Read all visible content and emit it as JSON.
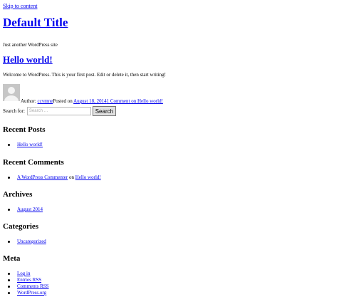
{
  "skip_link": "Skip to content",
  "site": {
    "title": "Default Title",
    "description": "Just another WordPress site"
  },
  "post": {
    "title": "Hello world!",
    "content": "Welcome to WordPress. This is your first post. Edit or delete it, then start writing!",
    "author_prefix": "Author:",
    "author": "ccvmne",
    "posted_prefix": "Posted on",
    "date": "August 18, 2014",
    "comments_link": "1 Comment on Hello world!"
  },
  "search": {
    "label": "Search for:",
    "placeholder": "Search …",
    "button": "Search"
  },
  "widgets": {
    "recent_posts": {
      "title": "Recent Posts",
      "items": [
        "Hello world!"
      ]
    },
    "recent_comments": {
      "title": "Recent Comments",
      "author": "A WordPress Commenter",
      "on": "on",
      "post": "Hello world!"
    },
    "archives": {
      "title": "Archives",
      "items": [
        "August 2014"
      ]
    },
    "categories": {
      "title": "Categories",
      "items": [
        "Uncategorized"
      ]
    },
    "meta": {
      "title": "Meta",
      "items": [
        "Log in",
        "Entries RSS",
        "Comments RSS",
        "WordPress.org"
      ]
    }
  }
}
